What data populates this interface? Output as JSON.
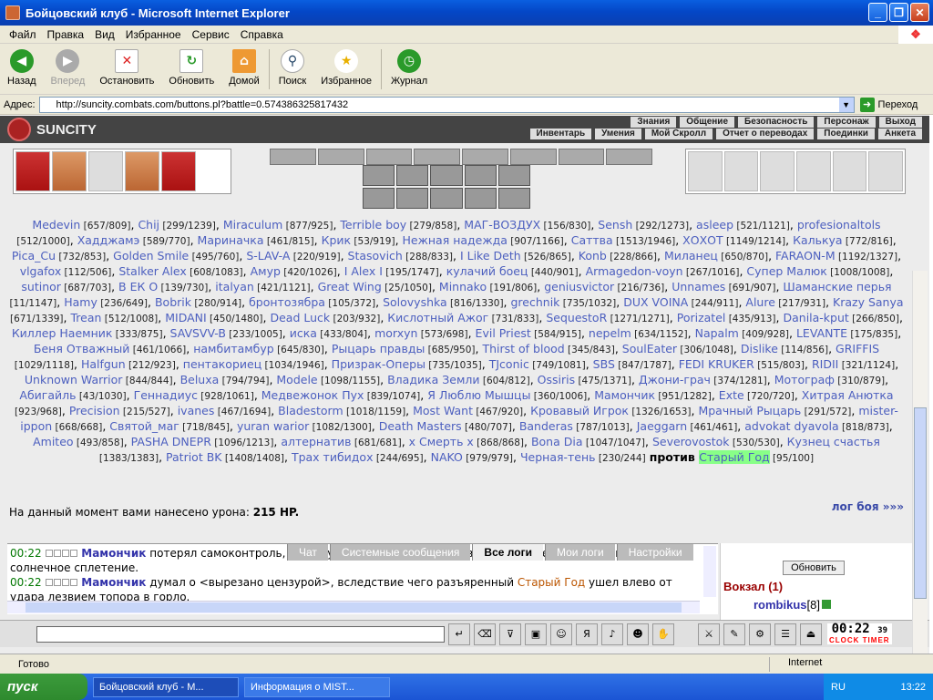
{
  "window": {
    "title": "Бойцовский клуб - Microsoft Internet Explorer"
  },
  "menu": [
    "Файл",
    "Правка",
    "Вид",
    "Избранное",
    "Сервис",
    "Справка"
  ],
  "toolbar": {
    "back": "Назад",
    "forward": "Вперед",
    "stop": "Остановить",
    "refresh": "Обновить",
    "home": "Домой",
    "search": "Поиск",
    "favorites": "Избранное",
    "history": "Журнал"
  },
  "address": {
    "label": "Адрес:",
    "url": "http://suncity.combats.com/buttons.pl?battle=0.574386325817432",
    "go": "Переход"
  },
  "game": {
    "logo": "SUNCITY",
    "nav_top": [
      "Знания",
      "Общение",
      "Безопасность",
      "Персонаж",
      "Выход"
    ],
    "nav_bottom": [
      "Инвентарь",
      "Умения",
      "Мой Скролл",
      "Отчет о переводах",
      "Поединки",
      "Анкета"
    ]
  },
  "fighters": [
    "Medevin [657/809]",
    "Chij [299/1239]",
    "Miraculum [877/925]",
    "Terrible boy [279/858]",
    "МАГ-ВОЗДУХ [156/830]",
    "Sensh [292/1273]",
    "asleep [521/1121]",
    "profesionaltols [512/1000]",
    "Хадджамэ [589/770]",
    "Мариначка [461/815]",
    "Крик [53/919]",
    "Нежная надежда [907/1166]",
    "Саттва [1513/1946]",
    "ХОХОТ [1149/1214]",
    "Калькуа [772/816]",
    "Pica_Cu [732/853]",
    "Golden Smile [495/760]",
    "S-LAV-A [220/919]",
    "Stasovich [288/833]",
    "I Like Deth [526/865]",
    "Konb [228/866]",
    "Миланец [650/870]",
    "FARAON-M [1192/1327]",
    "vlgafox [112/506]",
    "Stalker Alex [608/1083]",
    "Амур [420/1026]",
    "I Alex I [195/1747]",
    "кулачий боец [440/901]",
    "Armagedon-voyn [267/1016]",
    "Супер Малюк [1008/1008]",
    "sutinor [687/703]",
    "В ЕК О [139/730]",
    "italyan [421/1121]",
    "Great Wing [25/1050]",
    "Minnako [191/806]",
    "geniusvictor [216/736]",
    "Unnames [691/907]",
    "Шаманские перья [11/1147]",
    "Hamy [236/649]",
    "Bobrik [280/914]",
    "бронтозябра [105/372]",
    "Solovyshka [816/1330]",
    "grechnik [735/1032]",
    "DUX VOINA [244/911]",
    "Alure [217/931]",
    "Krazy Sanya [671/1339]",
    "Trean [512/1008]",
    "MIDANI [450/1480]",
    "Dead Luck [203/932]",
    "Кислотный Ажог [731/833]",
    "SequestoR [1271/1271]",
    "Porizatel [435/913]",
    "Danila-kput [266/850]",
    "Киллер Наемник [333/875]",
    "SAVSVV-B [233/1005]",
    "иска [433/804]",
    "morxyn [573/698]",
    "Evil Priest [584/915]",
    "nepelm [634/1152]",
    "Napalm [409/928]",
    "LEVANTE [175/835]",
    "Беня Отважный [461/1066]",
    "намбитамбур [645/830]",
    "Рыцарь правды [685/950]",
    "Thirst of blood [345/843]",
    "SoulEater [306/1048]",
    "Dislike [114/856]",
    "GRIFFIS [1029/1118]",
    "Halfgun [212/923]",
    "пентакориец [1034/1946]",
    "Призрак-Оперы [735/1035]",
    "TJconic [749/1081]",
    "SBS [847/1787]",
    "FEDI KRUKER [515/803]",
    "RIDII [321/1124]",
    "Unknown Warrior [844/844]",
    "Beluxa [794/794]",
    "Modele [1098/1155]",
    "Владика Земли [604/812]",
    "Ossiris [475/1371]",
    "Джони-грач [374/1281]",
    "Мотограф [310/879]",
    "Абигайль [43/1030]",
    "Геннадиус [928/1061]",
    "Медвежонок Пух [839/1074]",
    "Я Люблю Мышцы [360/1006]",
    "Мамончик [951/1282]",
    "Exte [720/720]",
    "Хитрая Анютка [923/968]",
    "Precision [215/527]",
    "ivanes [467/1694]",
    "Bladestorm [1018/1159]",
    "Most Want [467/920]",
    "Кровавый Игрок [1326/1653]",
    "Мрачный Рыцарь [291/572]",
    "mister-ippon [668/668]",
    "Святой_маг [718/845]",
    "yuran warior [1082/1300]",
    "Death Masters [480/707]",
    "Banderas [787/1013]",
    "Jaeggarn [461/461]",
    "advokat dyavola [818/873]",
    "Amiteo [493/858]",
    "PASHA DNEPR [1096/1213]",
    "алтернатив [681/681]",
    "х Смерть х [868/868]",
    "Bona Dia [1047/1047]",
    "Severovostok [530/530]",
    "Кузнец счастья [1383/1383]",
    "Patriot BK [1408/1408]",
    "Трах тибидох [244/695]",
    "NAKO [979/979]",
    "Черная-тень [230/244]"
  ],
  "versus": {
    "word": "против",
    "target": "Старый Год",
    "target_hp": "[95/100]"
  },
  "damage": {
    "label": "На данный момент вами нанесено урона:",
    "value": "215 HP."
  },
  "log_link": "лог боя »»»",
  "chat": {
    "tabs": [
      "Чат",
      "Системные сообщения",
      "Все логи",
      "Мои логи",
      "Настройки"
    ],
    "lines": [
      {
        "time": "00:22",
        "name": "Мамончик",
        "text": "потерял самоконтроль, но вдруг неожиданно ощутил в своей промежности ручкой топора в солнечное сплетение."
      },
      {
        "time": "00:22",
        "name": "Мамончик",
        "text": "думал о <вырезано цензурой>, вследствие чего разъяренный",
        "target": "Старый Год",
        "tail": "ушел влево от удара лезвием топора в горло."
      }
    ]
  },
  "right_panel": {
    "refresh": "Обновить",
    "location": "Вокзал (1)",
    "user": "rombikus",
    "level": "[8]"
  },
  "clock": {
    "time": "00:22",
    "sec": "39",
    "labels": "CLOCK TIMER"
  },
  "status": {
    "left": "Готово",
    "zone": "Internet"
  },
  "taskbar": {
    "start": "пуск",
    "tasks": [
      "Бойцовский клуб - M...",
      "Информация о MIST..."
    ],
    "lang": "RU",
    "time": "13:22"
  }
}
